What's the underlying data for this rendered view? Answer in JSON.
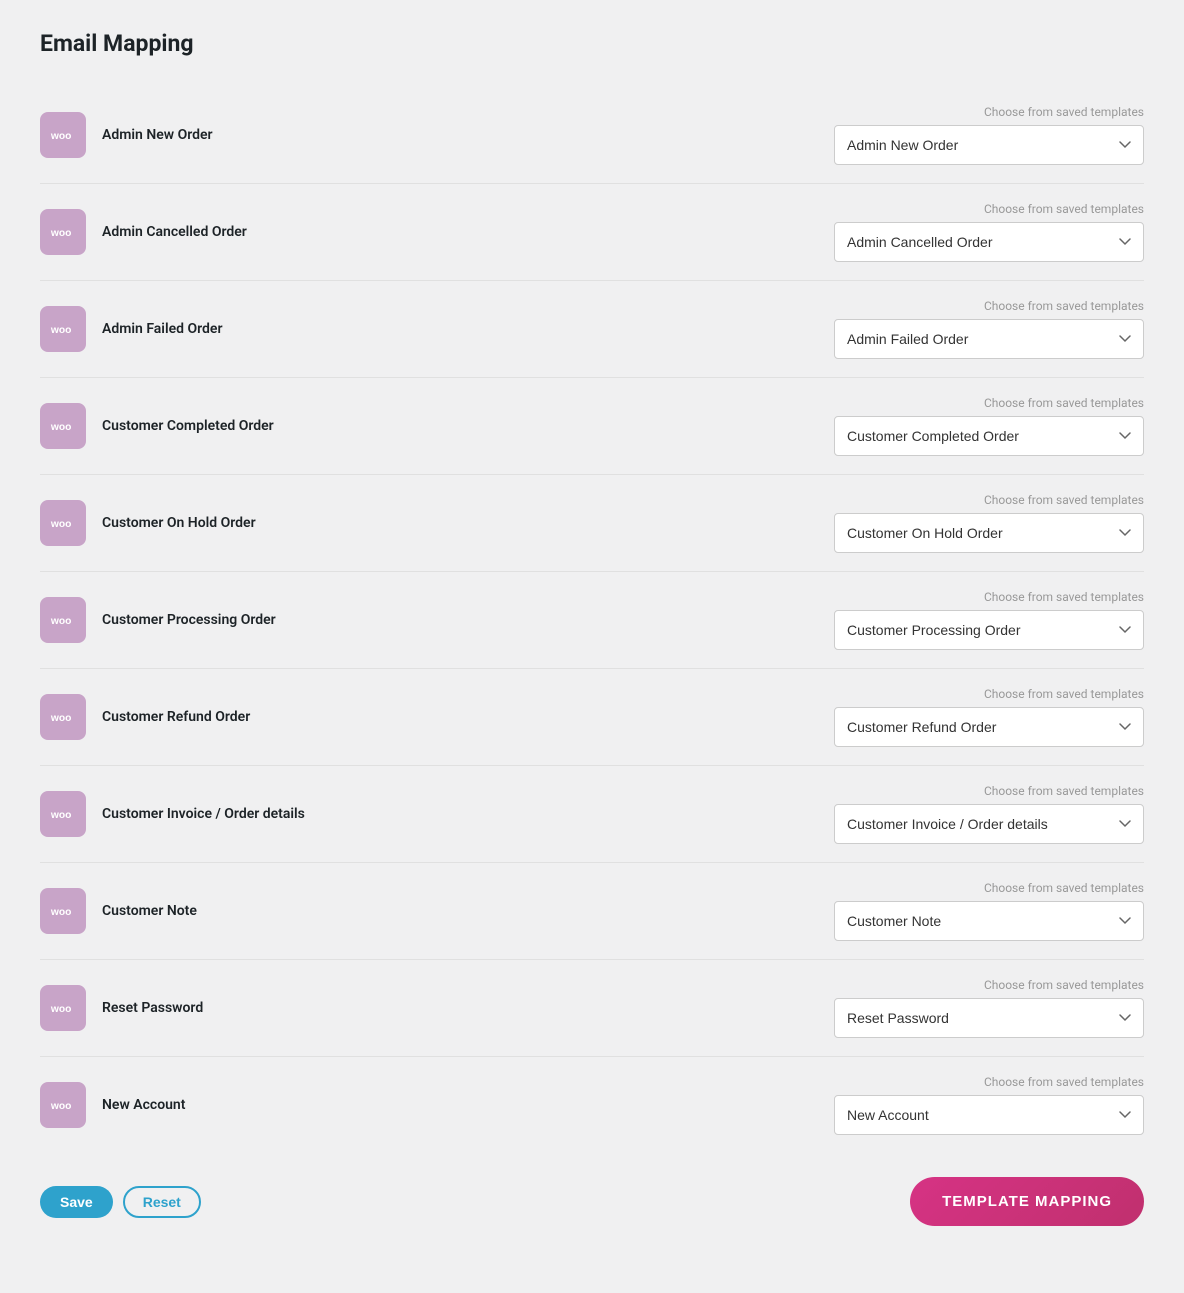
{
  "page": {
    "title": "Email Mapping"
  },
  "rows": [
    {
      "id": "admin-new-order",
      "label": "Admin New Order",
      "selectValue": "Admin New Order"
    },
    {
      "id": "admin-cancelled-order",
      "label": "Admin Cancelled Order",
      "selectValue": "Admin Cancelled Order"
    },
    {
      "id": "admin-failed-order",
      "label": "Admin Failed Order",
      "selectValue": "Admin Failed Order"
    },
    {
      "id": "customer-completed-order",
      "label": "Customer Completed Order",
      "selectValue": "Customer Completed Order"
    },
    {
      "id": "customer-on-hold-order",
      "label": "Customer On Hold Order",
      "selectValue": "Customer On Hold Order"
    },
    {
      "id": "customer-processing-order",
      "label": "Customer Processing Order",
      "selectValue": "Customer Processing Order"
    },
    {
      "id": "customer-refund-order",
      "label": "Customer Refund Order",
      "selectValue": "Customer Refund Order"
    },
    {
      "id": "customer-invoice-order-details",
      "label": "Customer Invoice / Order details",
      "selectValue": "Customer Invoice / Order details"
    },
    {
      "id": "customer-note",
      "label": "Customer Note",
      "selectValue": "Customer Note"
    },
    {
      "id": "reset-password",
      "label": "Reset Password",
      "selectValue": "Reset Password"
    },
    {
      "id": "new-account",
      "label": "New Account",
      "selectValue": "New Account"
    }
  ],
  "select_label": "Choose from saved templates",
  "buttons": {
    "save": "Save",
    "reset": "Reset",
    "template_mapping": "TEMPLATE MAPPING"
  }
}
